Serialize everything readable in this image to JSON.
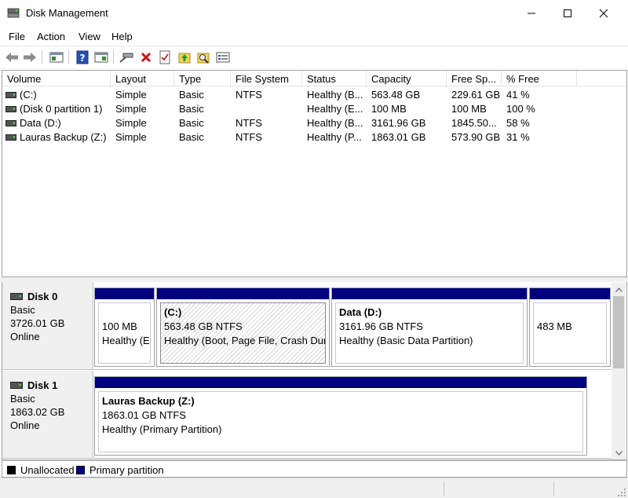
{
  "window": {
    "title": "Disk Management",
    "icon": "disk-management-icon"
  },
  "menu": {
    "items": [
      "File",
      "Action",
      "View",
      "Help"
    ]
  },
  "toolbar": {
    "icons": [
      "back-arrow-icon",
      "forward-arrow-icon",
      "show-hide-console-tree-icon",
      "help-icon",
      "properties-pane-icon",
      "connect-drive-icon",
      "delete-icon",
      "check-icon",
      "up-folder-icon",
      "search-folder-icon",
      "properties-icon"
    ]
  },
  "volume_list": {
    "columns": [
      "Volume",
      "Layout",
      "Type",
      "File System",
      "Status",
      "Capacity",
      "Free Sp...",
      "% Free"
    ],
    "rows": [
      {
        "volume": "(C:)",
        "layout": "Simple",
        "type": "Basic",
        "fs": "NTFS",
        "status": "Healthy (B...",
        "capacity": "563.48 GB",
        "free": "229.61 GB",
        "pct": "41 %"
      },
      {
        "volume": "(Disk 0 partition 1)",
        "layout": "Simple",
        "type": "Basic",
        "fs": "",
        "status": "Healthy (E...",
        "capacity": "100 MB",
        "free": "100 MB",
        "pct": "100 %"
      },
      {
        "volume": "Data (D:)",
        "layout": "Simple",
        "type": "Basic",
        "fs": "NTFS",
        "status": "Healthy (B...",
        "capacity": "3161.96 GB",
        "free": "1845.50...",
        "pct": "58 %"
      },
      {
        "volume": "Lauras Backup (Z:)",
        "layout": "Simple",
        "type": "Basic",
        "fs": "NTFS",
        "status": "Healthy (P...",
        "capacity": "1863.01 GB",
        "free": "573.90 GB",
        "pct": "31 %"
      }
    ]
  },
  "disks": [
    {
      "name": "Disk 0",
      "type": "Basic",
      "size": "3726.01 GB",
      "state": "Online",
      "partitions": [
        {
          "title": "",
          "line1": "100 MB",
          "line2": "Healthy (EF"
        },
        {
          "title": "(C:)",
          "line1": "563.48 GB NTFS",
          "line2": "Healthy (Boot, Page File, Crash Dump"
        },
        {
          "title": "Data  (D:)",
          "line1": "3161.96 GB NTFS",
          "line2": "Healthy (Basic Data Partition)"
        },
        {
          "title": "",
          "line1": "483 MB",
          "line2": ""
        }
      ]
    },
    {
      "name": "Disk 1",
      "type": "Basic",
      "size": "1863.02 GB",
      "state": "Online",
      "partitions": [
        {
          "title": "Lauras Backup  (Z:)",
          "line1": "1863.01 GB NTFS",
          "line2": "Healthy (Primary Partition)"
        }
      ]
    }
  ],
  "legend": {
    "unallocated": "Unallocated",
    "primary": "Primary partition",
    "unallocated_color": "#000000",
    "primary_color": "#000080"
  }
}
